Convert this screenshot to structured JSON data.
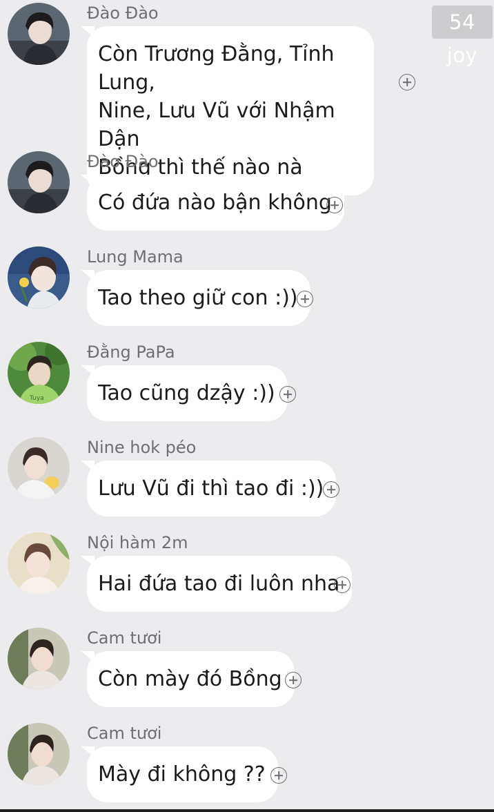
{
  "watermark": "54 joy",
  "colors": {
    "background": "#ececee",
    "bubble": "#ffffff",
    "sender_name": "#6f6f73",
    "message_text": "#1b1b1b"
  },
  "messages": [
    {
      "sender": "Đào Đào",
      "text": "Còn Trương Đằng, Tỉnh Lung,\nNine, Lưu Vũ với Nhậm Dận\nBồng thì thế nào nà",
      "avatar": "dao-dao-avatar",
      "react_icon": "add-reaction-icon"
    },
    {
      "sender": "Đào Đào",
      "text": "Có đứa nào bận không",
      "avatar": "dao-dao-avatar",
      "react_icon": "add-reaction-icon"
    },
    {
      "sender": "Lung Mama",
      "text": "Tao theo giữ con :))",
      "avatar": "lung-mama-avatar",
      "react_icon": "add-reaction-icon"
    },
    {
      "sender": "Đằng PaPa",
      "text": "Tao cũng dzậy :))",
      "avatar": "dang-papa-avatar",
      "react_icon": "add-reaction-icon"
    },
    {
      "sender": "Nine hok péo",
      "text": "Lưu Vũ đi thì tao đi :))",
      "avatar": "nine-avatar",
      "react_icon": "add-reaction-icon"
    },
    {
      "sender": "Nội hàm 2m",
      "text": "Hai đứa tao đi luôn nha",
      "avatar": "noi-ham-avatar",
      "react_icon": "add-reaction-icon"
    },
    {
      "sender": "Cam tươi",
      "text": "Còn mày đó Bồng",
      "avatar": "cam-tuoi-avatar",
      "react_icon": "add-reaction-icon"
    },
    {
      "sender": "Cam tươi",
      "text": "Mày đi không ??",
      "avatar": "cam-tuoi-avatar",
      "react_icon": "add-reaction-icon"
    }
  ]
}
